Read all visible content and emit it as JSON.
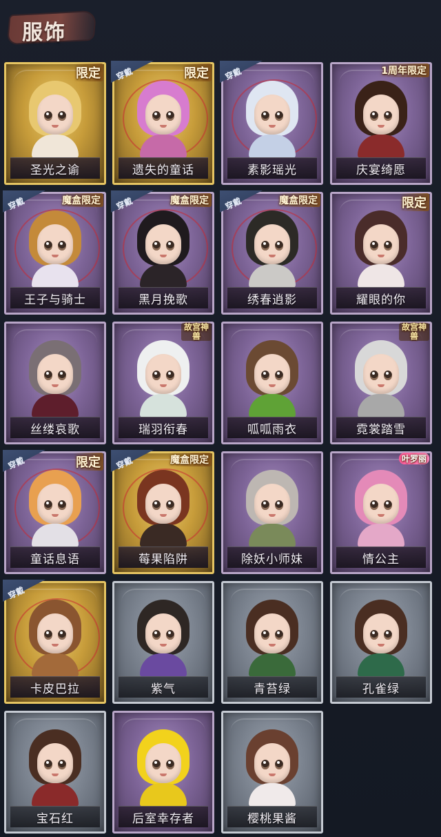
{
  "header": {
    "title": "服饰"
  },
  "tags": {
    "wear": "穿戴"
  },
  "costumes": [
    {
      "name": "圣光之谕",
      "badge": "限定",
      "style": "gold",
      "worn": false,
      "hair": "#e8c870",
      "body": "#f0e6d8"
    },
    {
      "name": "遗失的童话",
      "badge": "限定",
      "style": "gold",
      "worn": true,
      "hair": "#d77ccf",
      "body": "#c66aa8"
    },
    {
      "name": "素影瑶光",
      "badge": "",
      "style": "purple",
      "worn": true,
      "hair": "#dfe6f2",
      "body": "#c4d0e6"
    },
    {
      "name": "庆宴绮愿",
      "badge": "1周年限定",
      "style": "purple",
      "worn": false,
      "hair": "#3a2218",
      "body": "#8a2b2b"
    },
    {
      "name": "王子与骑士",
      "badge": "魔盒限定",
      "style": "purple",
      "worn": true,
      "hair": "#c48a3a",
      "body": "#e8e2ee"
    },
    {
      "name": "黑月挽歌",
      "badge": "魔盒限定",
      "style": "purple",
      "worn": true,
      "hair": "#1f1a1e",
      "body": "#2b2428"
    },
    {
      "name": "绣春逍影",
      "badge": "魔盒限定",
      "style": "purple",
      "worn": true,
      "hair": "#2c2a26",
      "body": "#cbc9c6"
    },
    {
      "name": "耀眼的你",
      "badge": "限定",
      "style": "purple",
      "worn": false,
      "hair": "#4a2c2a",
      "body": "#efe6e6"
    },
    {
      "name": "丝缕哀歌",
      "badge": "",
      "style": "purple",
      "worn": false,
      "hair": "#7a6f74",
      "body": "#5e1e2c"
    },
    {
      "name": "瑞羽衔春",
      "badge": "故宫神兽",
      "style": "purple",
      "worn": false,
      "hair": "#eef0f0",
      "body": "#d6e2dc"
    },
    {
      "name": "呱呱雨衣",
      "badge": "",
      "style": "purple",
      "worn": false,
      "hair": "#6b4a33",
      "body": "#5fa236"
    },
    {
      "name": "霓裳踏雪",
      "badge": "故宫神兽",
      "style": "purple",
      "worn": false,
      "hair": "#d8d8d8",
      "body": "#a8a8a8"
    },
    {
      "name": "童话息语",
      "badge": "限定",
      "style": "purple",
      "worn": true,
      "hair": "#e8a050",
      "body": "#e3e0e6"
    },
    {
      "name": "莓果陷阱",
      "badge": "魔盒限定",
      "style": "gold",
      "worn": true,
      "hair": "#7a3520",
      "body": "#3a2a24"
    },
    {
      "name": "除妖小师妹",
      "badge": "",
      "style": "purple",
      "worn": false,
      "hair": "#bdb7b2",
      "body": "#7a8a5a"
    },
    {
      "name": "情公主",
      "badge": "叶罗丽",
      "style": "purple",
      "worn": false,
      "hair": "#e48ab8",
      "body": "#e4a8c8"
    },
    {
      "name": "卡皮巴拉",
      "badge": "",
      "style": "gold",
      "worn": true,
      "hair": "#8a5530",
      "body": "#a36a3a"
    },
    {
      "name": "紫气",
      "badge": "",
      "style": "gray",
      "worn": false,
      "hair": "#2e2724",
      "body": "#6a4aa0"
    },
    {
      "name": "青苔绿",
      "badge": "",
      "style": "gray",
      "worn": false,
      "hair": "#4a2e22",
      "body": "#3a6a3a"
    },
    {
      "name": "孔雀绿",
      "badge": "",
      "style": "gray",
      "worn": false,
      "hair": "#4a2e22",
      "body": "#2e6a4a"
    },
    {
      "name": "宝石红",
      "badge": "",
      "style": "gray",
      "worn": false,
      "hair": "#4a2e22",
      "body": "#8a2a2a"
    },
    {
      "name": "后室幸存者",
      "badge": "",
      "style": "purple",
      "worn": false,
      "hair": "#f2d21c",
      "body": "#e8c81c"
    },
    {
      "name": "樱桃果酱",
      "badge": "",
      "style": "gray",
      "worn": false,
      "hair": "#6a4030",
      "body": "#f0eaea"
    }
  ]
}
